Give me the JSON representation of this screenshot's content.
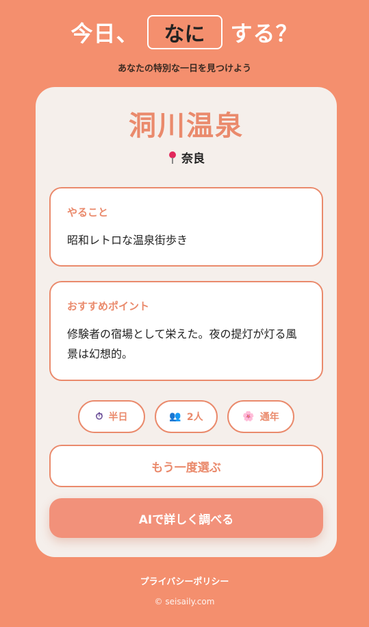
{
  "header": {
    "title_before": "今日、",
    "title_box": "なに",
    "title_after": "する？",
    "subtitle": "あなたの特別な一日を見つけよう"
  },
  "card": {
    "place_name": "洞川温泉",
    "location": "奈良",
    "location_icon": "pin-icon",
    "sections": [
      {
        "label": "やること",
        "text": "昭和レトロな温泉街歩き"
      },
      {
        "label": "おすすめポイント",
        "text": "修験者の宿場として栄えた。夜の提灯が灯る風景は幻想的。"
      }
    ],
    "tags": [
      {
        "icon": "⏱",
        "icon_name": "stopwatch-icon",
        "label": "半日"
      },
      {
        "icon": "👥",
        "icon_name": "people-icon",
        "label": "2人"
      },
      {
        "icon": "🌸",
        "icon_name": "blossom-icon",
        "label": "通年"
      }
    ],
    "retry_label": "もう一度選ぶ",
    "ai_label": "AIで詳しく調べる"
  },
  "footer": {
    "privacy_label": "プライバシーポリシー",
    "copyright": "© seisaily.com"
  },
  "colors": {
    "background": "#F48F6E",
    "accent": "#EA8A6C",
    "card": "#F5EFEB",
    "ai_button": "#F2917A"
  }
}
